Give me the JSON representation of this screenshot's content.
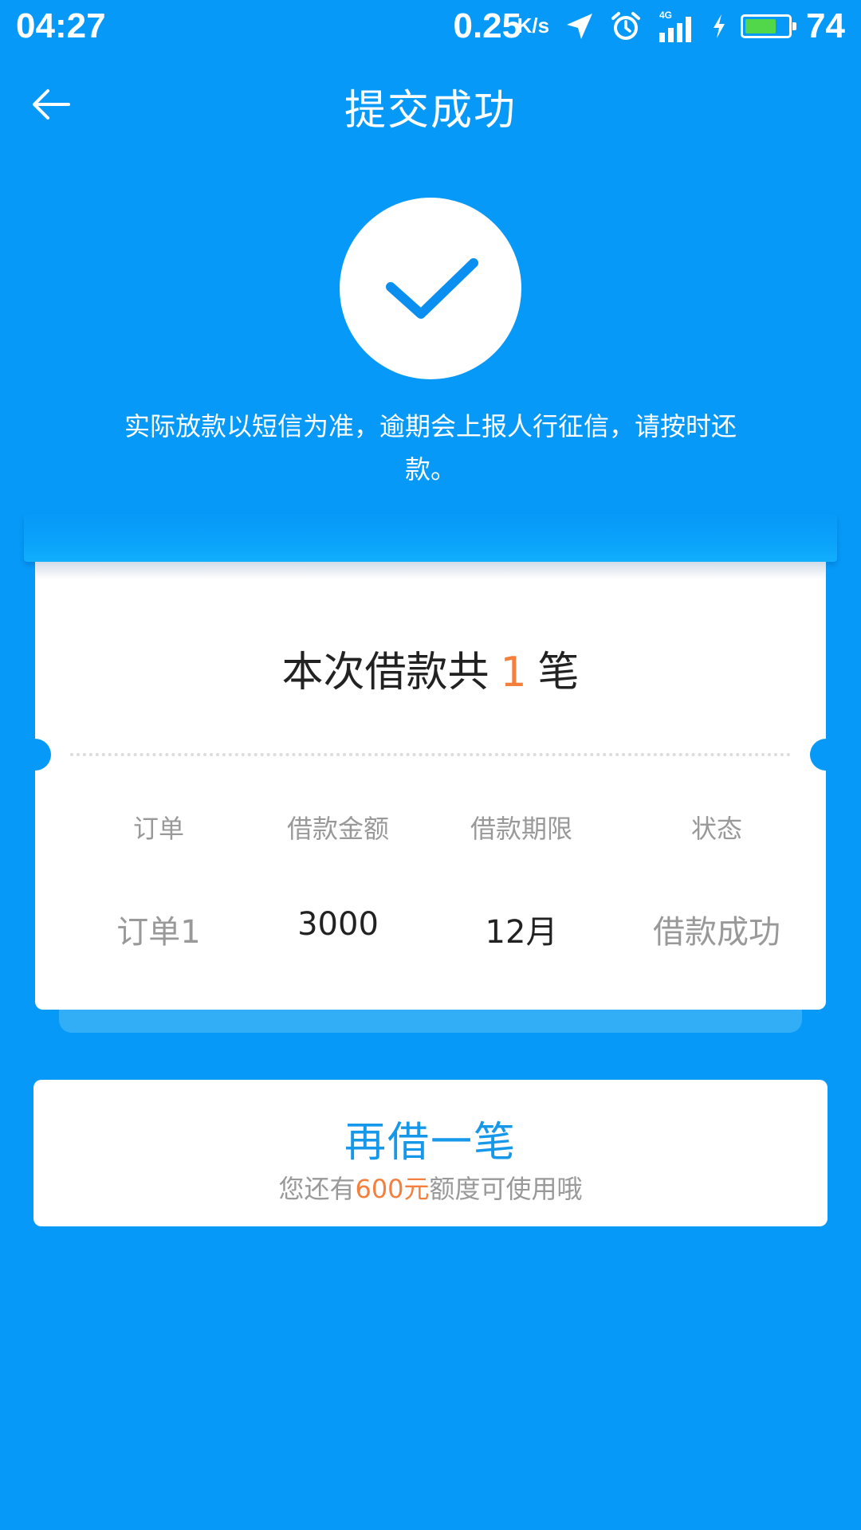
{
  "status_bar": {
    "time": "04:27",
    "net_speed": "0.25",
    "net_unit": "K/s",
    "network": "4G",
    "battery_level": 74,
    "battery_text": "74",
    "icons": [
      "location-arrow-icon",
      "alarm-icon",
      "signal-4g-icon",
      "charging-icon",
      "battery-icon"
    ]
  },
  "header": {
    "back_icon": "arrow-left-icon",
    "title": "提交成功"
  },
  "success": {
    "icon": "checkmark-icon",
    "notice": "实际放款以短信为准，逾期会上报人行征信，请按时还款。"
  },
  "summary": {
    "prefix": "本次借款共",
    "count": "1",
    "suffix": "笔"
  },
  "table": {
    "headers": [
      "订单",
      "借款金额",
      "借款期限",
      "状态"
    ],
    "rows": [
      [
        "订单1",
        "3000",
        "12月",
        "借款成功"
      ]
    ]
  },
  "borrow_again": {
    "title": "再借一笔",
    "sub_prefix": "您还有",
    "sub_amount": "600元",
    "sub_suffix": "额度可使用哦"
  },
  "colors": {
    "background": "#0799f7",
    "accent_orange": "#f5803e",
    "button_text_blue": "#1597ea",
    "muted_text": "#999999"
  }
}
